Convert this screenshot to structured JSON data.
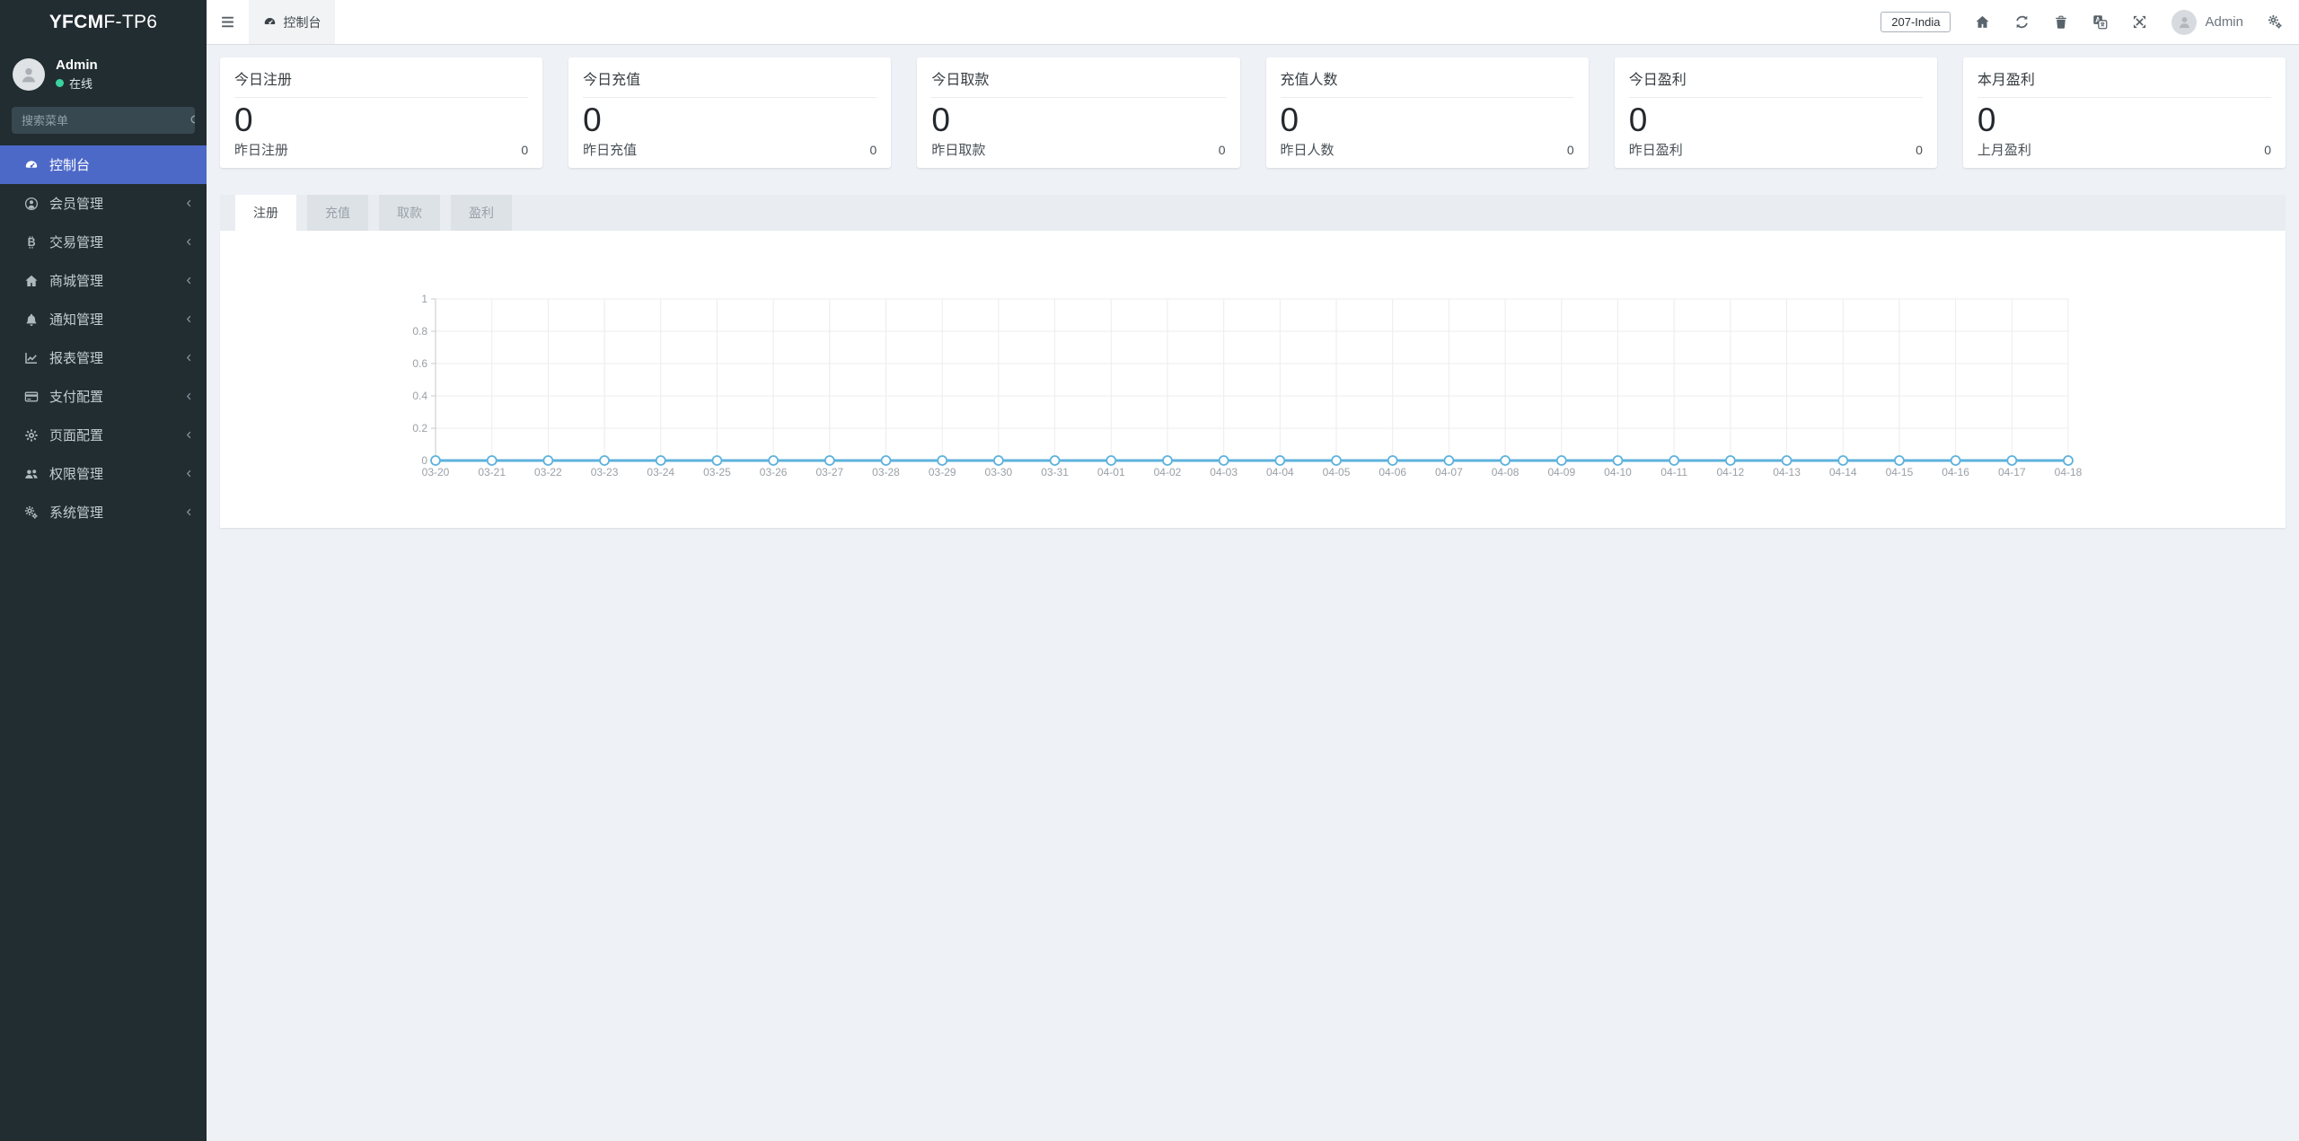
{
  "colors": {
    "sidebar_bg": "#222d32",
    "active_item_bg": "#4d69c8",
    "online_dot": "#3ad29f",
    "page_bg": "#eef1f5",
    "chart_line": "#5db2dc"
  },
  "sidebar": {
    "logo": {
      "bold": "YFCM",
      "light": "F-TP6"
    },
    "user": {
      "name": "Admin",
      "status": "在线"
    },
    "search_placeholder": "搜索菜单",
    "items": [
      {
        "label": "控制台",
        "icon": "tachometer-icon",
        "active": true,
        "has_submenu": false
      },
      {
        "label": "会员管理",
        "icon": "user-circle-icon",
        "active": false,
        "has_submenu": true
      },
      {
        "label": "交易管理",
        "icon": "bitcoin-icon",
        "active": false,
        "has_submenu": true
      },
      {
        "label": "商城管理",
        "icon": "home-icon",
        "active": false,
        "has_submenu": true
      },
      {
        "label": "通知管理",
        "icon": "bell-icon",
        "active": false,
        "has_submenu": true
      },
      {
        "label": "报表管理",
        "icon": "chart-line-icon",
        "active": false,
        "has_submenu": true
      },
      {
        "label": "支付配置",
        "icon": "credit-card-icon",
        "active": false,
        "has_submenu": true
      },
      {
        "label": "页面配置",
        "icon": "gear-icon",
        "active": false,
        "has_submenu": true
      },
      {
        "label": "权限管理",
        "icon": "users-icon",
        "active": false,
        "has_submenu": true
      },
      {
        "label": "系统管理",
        "icon": "gears-icon",
        "active": false,
        "has_submenu": true
      }
    ]
  },
  "topbar": {
    "breadcrumb": "控制台",
    "region": "207-India",
    "user": "Admin",
    "icons": [
      "menu-icon",
      "home-icon",
      "refresh-icon",
      "trash-icon",
      "translate-icon",
      "fullscreen-icon",
      "gears-icon"
    ]
  },
  "stat_cards": [
    {
      "title": "今日注册",
      "value": "0",
      "sub_label": "昨日注册",
      "sub_value": "0"
    },
    {
      "title": "今日充值",
      "value": "0",
      "sub_label": "昨日充值",
      "sub_value": "0"
    },
    {
      "title": "今日取款",
      "value": "0",
      "sub_label": "昨日取款",
      "sub_value": "0"
    },
    {
      "title": "充值人数",
      "value": "0",
      "sub_label": "昨日人数",
      "sub_value": "0"
    },
    {
      "title": "今日盈利",
      "value": "0",
      "sub_label": "昨日盈利",
      "sub_value": "0"
    },
    {
      "title": "本月盈利",
      "value": "0",
      "sub_label": "上月盈利",
      "sub_value": "0"
    }
  ],
  "tabs": [
    {
      "label": "注册",
      "active": true
    },
    {
      "label": "充值",
      "active": false
    },
    {
      "label": "取款",
      "active": false
    },
    {
      "label": "盈利",
      "active": false
    }
  ],
  "chart_data": {
    "type": "line",
    "title": "",
    "x": [
      "03-20",
      "03-21",
      "03-22",
      "03-23",
      "03-24",
      "03-25",
      "03-26",
      "03-27",
      "03-28",
      "03-29",
      "03-30",
      "03-31",
      "04-01",
      "04-02",
      "04-03",
      "04-04",
      "04-05",
      "04-06",
      "04-07",
      "04-08",
      "04-09",
      "04-10",
      "04-11",
      "04-12",
      "04-13",
      "04-14",
      "04-15",
      "04-16",
      "04-17",
      "04-18"
    ],
    "series": [
      {
        "name": "注册",
        "values": [
          0,
          0,
          0,
          0,
          0,
          0,
          0,
          0,
          0,
          0,
          0,
          0,
          0,
          0,
          0,
          0,
          0,
          0,
          0,
          0,
          0,
          0,
          0,
          0,
          0,
          0,
          0,
          0,
          0,
          0
        ]
      }
    ],
    "ylim": [
      0,
      1
    ],
    "yticks": [
      0,
      0.2,
      0.4,
      0.6,
      0.8,
      1
    ],
    "xlabel": "",
    "ylabel": "",
    "grid": true,
    "legend_position": "none",
    "line_color": "#5db2dc",
    "marker": "hollow-circle"
  }
}
